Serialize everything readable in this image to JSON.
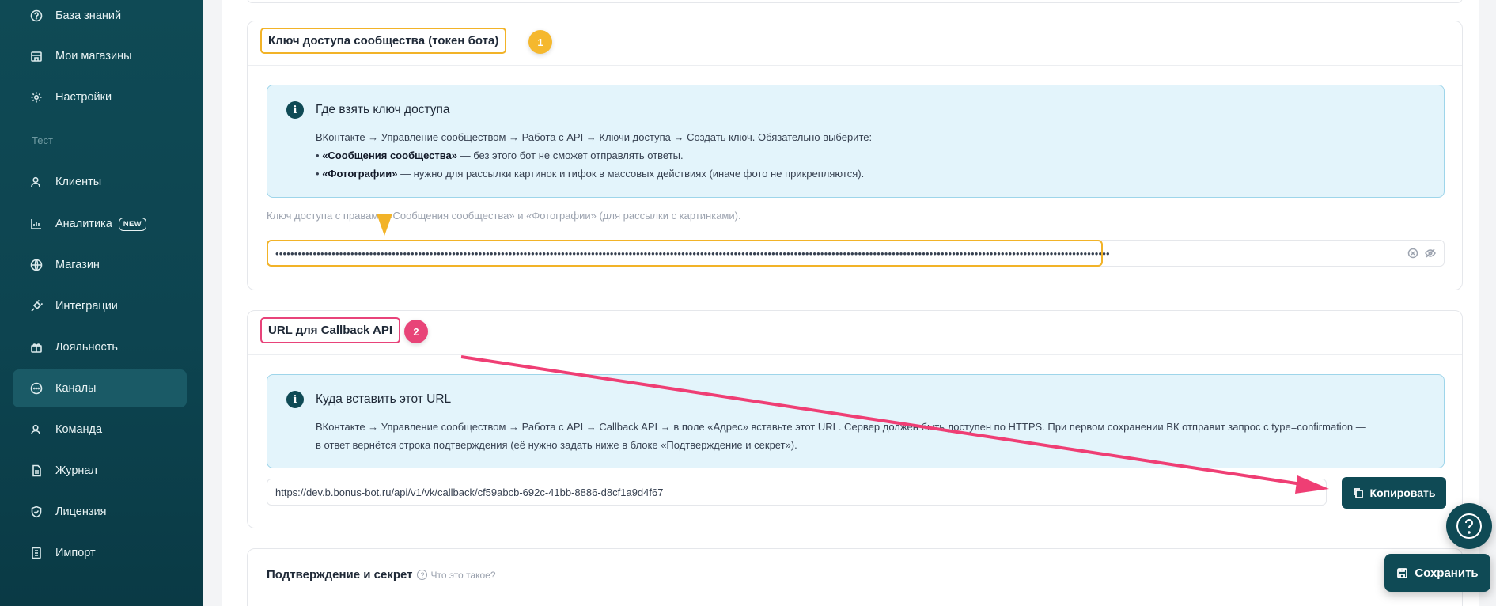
{
  "sidebar": {
    "items": [
      {
        "label": "База знаний",
        "icon": "question-circle-icon"
      },
      {
        "label": "Мои магазины",
        "icon": "store-icon"
      },
      {
        "label": "Настройки",
        "icon": "gear-icon"
      },
      {
        "label": "Клиенты",
        "icon": "users-icon"
      },
      {
        "label": "Аналитика",
        "icon": "chart-icon",
        "badge": "NEW"
      },
      {
        "label": "Магазин",
        "icon": "globe-icon"
      },
      {
        "label": "Интеграции",
        "icon": "plug-icon"
      },
      {
        "label": "Лояльность",
        "icon": "gift-icon"
      },
      {
        "label": "Каналы",
        "icon": "chat-icon",
        "active": true
      },
      {
        "label": "Команда",
        "icon": "team-icon"
      },
      {
        "label": "Журнал",
        "icon": "journal-icon"
      },
      {
        "label": "Лицензия",
        "icon": "shield-icon"
      },
      {
        "label": "Импорт",
        "icon": "import-icon"
      }
    ],
    "section_label": "Тест"
  },
  "token_card": {
    "title": "Ключ доступа сообщества (токен бота)",
    "step": "1",
    "info_title": "Где взять ключ доступа",
    "info_line1": "ВКонтакте → Управление сообществом → Работа с API → Ключи доступа → Создать ключ. Обязательно выберите:",
    "info_line2_bold": "«Сообщения сообщества»",
    "info_line2_rest": " — без этого бот не сможет отправлять ответы.",
    "info_line3_bold": "«Фотографии»",
    "info_line3_rest": " — нужно для рассылки картинок и гифок в массовых действиях (иначе фото не прикрепляются).",
    "bullet": "•",
    "hint": "Ключ доступа с правами «Сообщения сообщества» и «Фотографии» (для рассылки с картинками).",
    "value": "••••••••••••••••••••••••••••••••••••••••••••••••••••••••••••••••••••••••••••••••••••••••••••••••••••••••••••••••••••••••••••••••••••••••••••••••••••••••••••••••••••••••••••••••••••••••••••••••••••••••••••••••••••••••••••••"
  },
  "callback_card": {
    "title": "URL для Callback API",
    "step": "2",
    "info_title": "Куда вставить этот URL",
    "info_line1": "ВКонтакте → Управление сообществом → Работа с API → Callback API → в поле «Адрес» вставьте этот URL. Сервер должен быть доступен по HTTPS. При первом сохранении ВК отправит запрос с type=confirmation —",
    "info_line2": "в ответ вернётся строка подтверждения (её нужно задать ниже в блоке «Подтверждение и секрет»).",
    "url": "https://dev.b.bonus-bot.ru/api/v1/vk/callback/cf59abcb-692c-41bb-8886-d8cf1a9d4f67",
    "copy_label": "Копировать"
  },
  "confirm_card": {
    "title": "Подтверждение и секрет",
    "help_link": "Что это такое?",
    "help_glyph": "?"
  },
  "save_label": "Сохранить",
  "colors": {
    "accent": "#0f4a55",
    "highlight_yellow": "#f2b328",
    "highlight_pink": "#e8437a"
  }
}
